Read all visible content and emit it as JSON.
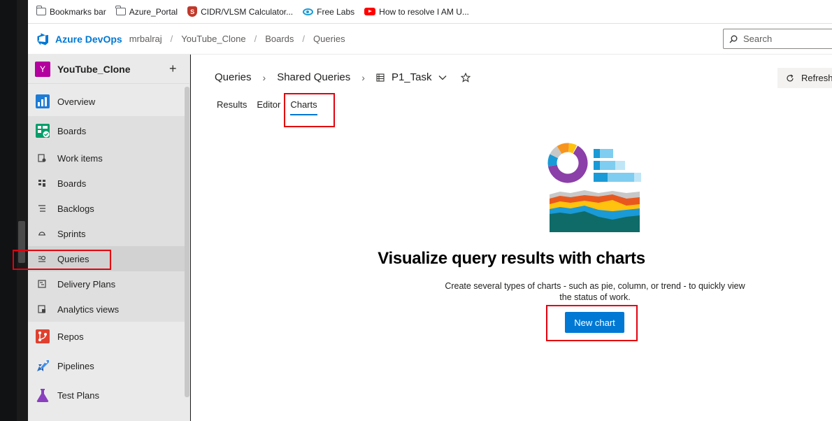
{
  "bookmarks": [
    {
      "label": "Bookmarks bar",
      "icon": "folder-icon"
    },
    {
      "label": "Azure_Portal",
      "icon": "folder-icon"
    },
    {
      "label": "CIDR/VLSM Calculator...",
      "icon": "shield-s-icon"
    },
    {
      "label": "Free Labs",
      "icon": "eye-icon"
    },
    {
      "label": "How to resolve I AM U...",
      "icon": "youtube-icon"
    }
  ],
  "header": {
    "brand": "Azure DevOps",
    "breadcrumbs": [
      "mrbalraj",
      "YouTube_Clone",
      "Boards",
      "Queries"
    ],
    "separator": "/",
    "search_placeholder": "Search"
  },
  "sidebar": {
    "project_initial": "Y",
    "project_name": "YouTube_Clone",
    "add_label": "+",
    "items": {
      "overview": "Overview",
      "boards": "Boards",
      "work_items": "Work items",
      "boards_sub": "Boards",
      "backlogs": "Backlogs",
      "sprints": "Sprints",
      "queries": "Queries",
      "delivery_plans": "Delivery Plans",
      "analytics_views": "Analytics views",
      "repos": "Repos",
      "pipelines": "Pipelines",
      "test_plans": "Test Plans"
    }
  },
  "main": {
    "crumbs": [
      "Queries",
      "Shared Queries"
    ],
    "query_name": "P1_Task",
    "refresh_label": "Refresh",
    "tabs": [
      "Results",
      "Editor",
      "Charts"
    ],
    "active_tab": "Charts",
    "hero_title": "Visualize query results with charts",
    "hero_desc": "Create several types of charts - such as pie, column, or trend - to quickly view the status of work.",
    "new_chart_label": "New chart"
  },
  "colors": {
    "accent": "#0078d4",
    "highlight": "#e3000f",
    "project_avatar": "#b4009e"
  }
}
